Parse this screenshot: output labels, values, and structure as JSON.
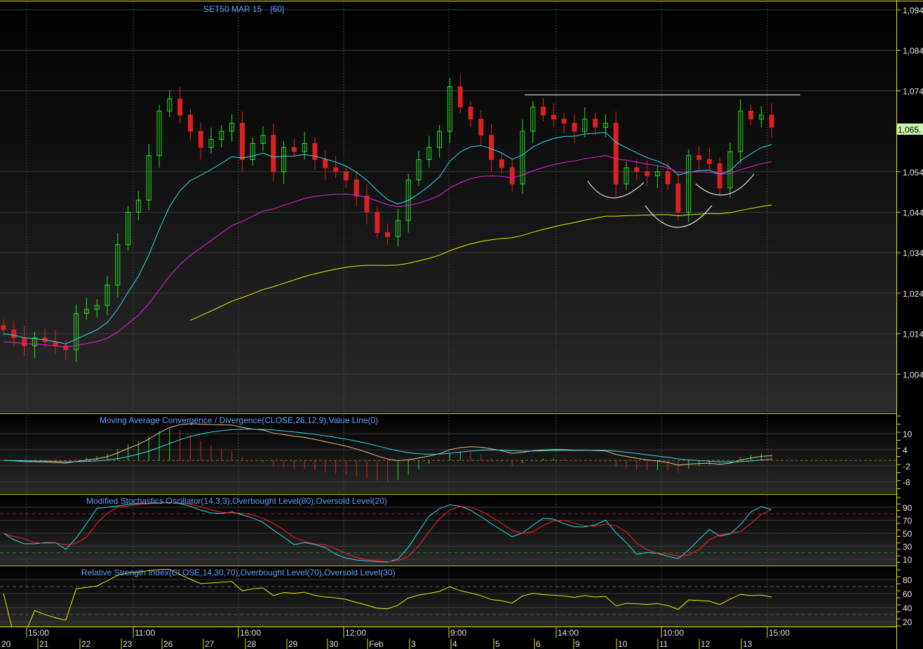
{
  "header": {
    "title": "SET50 MAR 15",
    "interval": "[60]"
  },
  "last_price_label": "1,065.",
  "colors": {
    "up": "#22dd22",
    "down": "#dd2020",
    "neutral": "#bbbbbb",
    "ma_fast": "#33d6e6",
    "ma_mid": "#e020e0",
    "ma_slow": "#e8e800",
    "axis": "#e8e800",
    "title": "#5aa0ff",
    "last_bg": "#c8f7b0"
  },
  "chart_data": [
    {
      "type": "candlestick",
      "title": "SET50 MAR 15 [60]",
      "ylim": [
        1000,
        1098
      ],
      "y_ticks": [
        "1,094",
        "1,084",
        "1,074",
        "1,054",
        "1,044",
        "1,034",
        "1,024",
        "1,014",
        "1,004"
      ],
      "y_tick_values": [
        1094,
        1084,
        1074,
        1054,
        1044,
        1034,
        1024,
        1014,
        1004
      ],
      "close": [
        1015,
        1013,
        1011,
        1013,
        1012,
        1011,
        1010,
        1019,
        1020,
        1021,
        1026,
        1036,
        1044,
        1047,
        1058,
        1069,
        1072,
        1068,
        1064,
        1060,
        1062,
        1064,
        1066,
        1057,
        1061,
        1063,
        1054,
        1060,
        1059,
        1061,
        1057,
        1055,
        1054,
        1052,
        1048,
        1044,
        1039,
        1038,
        1042,
        1052,
        1057,
        1060,
        1064,
        1075,
        1070,
        1067,
        1063,
        1057,
        1055,
        1051,
        1064,
        1070,
        1068,
        1067,
        1066,
        1064,
        1067,
        1065,
        1066,
        1051,
        1055,
        1054,
        1053,
        1054,
        1051,
        1044,
        1058,
        1057,
        1056,
        1050,
        1059,
        1069,
        1067,
        1068,
        1065
      ],
      "moving_averages": [
        {
          "name": "fast",
          "period": 10
        },
        {
          "name": "mid",
          "period": 25
        },
        {
          "name": "slow",
          "period": 60
        }
      ],
      "resistance_line": 1073,
      "last_value": 1065
    },
    {
      "type": "line",
      "title": "Moving Average Convergence / Divergence(CLOSE,26,12,9),Value Line(0)",
      "y_ticks": [
        "10",
        "4",
        "-2",
        "-8"
      ],
      "y_tick_values": [
        10,
        4,
        -2,
        -8
      ],
      "ylim": [
        -13,
        18
      ]
    },
    {
      "type": "line",
      "title": "Modified Stochastics Oscillator(14,3,3),Overbought Level(80),Oversold Level(20)",
      "y_ticks": [
        "90",
        "70",
        "50",
        "30",
        "10"
      ],
      "y_tick_values": [
        90,
        70,
        50,
        30,
        10
      ],
      "ylim": [
        0,
        100
      ],
      "levels": [
        80,
        20
      ]
    },
    {
      "type": "line",
      "title": "Relative Strength Index(CLOSE,14,30,70),Overbought Level(70),Oversold Level(30)",
      "y_ticks": [
        "80",
        "60",
        "40",
        "20"
      ],
      "y_tick_values": [
        80,
        60,
        40,
        20
      ],
      "ylim": [
        10,
        90
      ],
      "levels": [
        70,
        30
      ]
    }
  ],
  "time_axis": {
    "times": [
      "15:00",
      "11:00",
      "16:00",
      "12:00",
      "9:00",
      "14:00",
      "10:00",
      "15:00"
    ],
    "dates": [
      "20",
      "21",
      "22",
      "23",
      "26",
      "27",
      "28",
      "29",
      "30",
      "Feb",
      "3",
      "4",
      "5",
      "6",
      "9",
      "10",
      "11",
      "12",
      "13"
    ]
  }
}
